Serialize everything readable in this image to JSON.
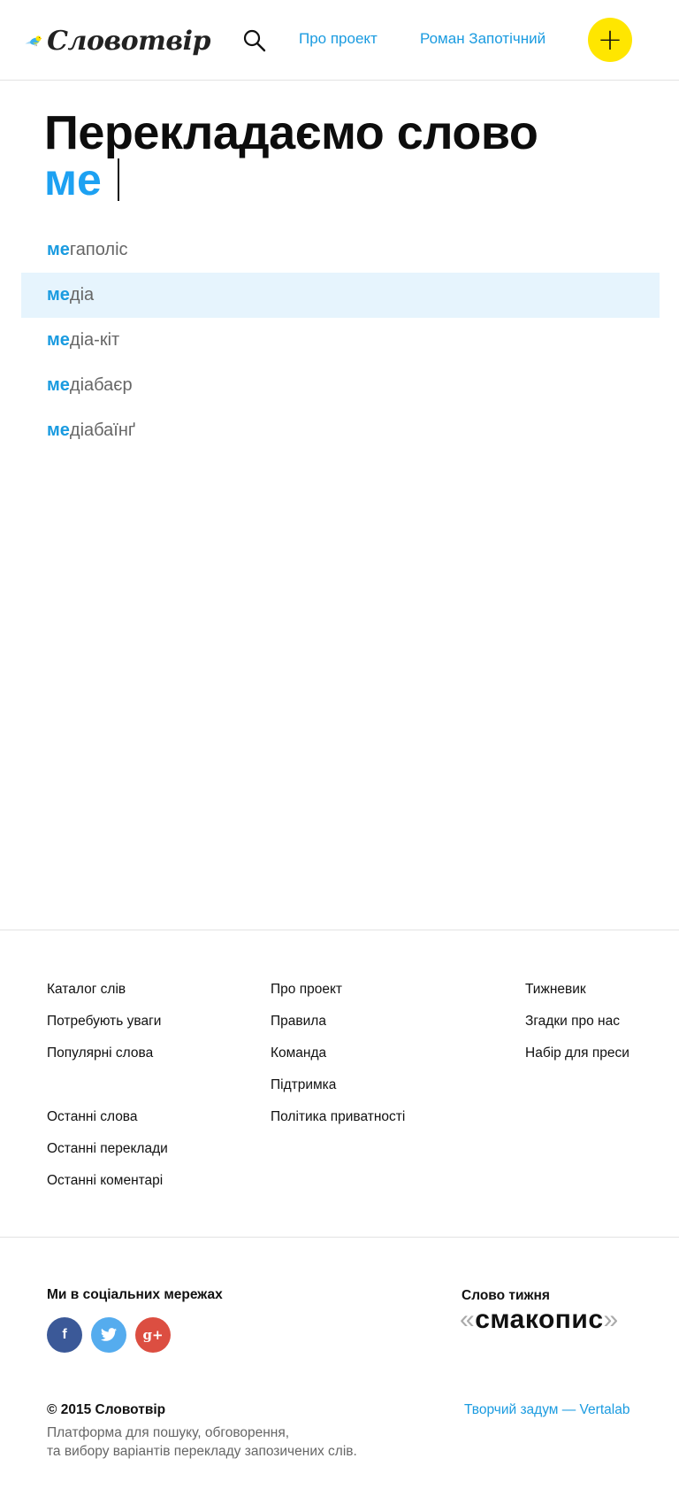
{
  "header": {
    "logo_text": "Словотвір",
    "nav": {
      "about": "Про проект",
      "user": "Роман Запотічний"
    },
    "add_icon": "+"
  },
  "search": {
    "title": "Перекладаємо слово",
    "query": "ме",
    "suggestions": [
      {
        "prefix": "ме",
        "rest": "гаполіс"
      },
      {
        "prefix": "ме",
        "rest": "діа"
      },
      {
        "prefix": "ме",
        "rest": "діа-кіт"
      },
      {
        "prefix": "ме",
        "rest": "діабаєр"
      },
      {
        "prefix": "ме",
        "rest": "діабаїнґ"
      }
    ]
  },
  "footer": {
    "col1": [
      "Каталог слів",
      "Потребують уваги",
      "Популярні слова",
      "Останні слова",
      "Останні переклади",
      "Останні коментарі"
    ],
    "col2": [
      "Про проект",
      "Правила",
      "Команда",
      "Підтримка",
      "Політика приватності"
    ],
    "col3": [
      "Тижневик",
      "Згадки про нас",
      "Набір для преси"
    ],
    "social_title": "Ми в соціальних мережах",
    "social": {
      "facebook": "f",
      "twitter": "t",
      "gplus": "g+"
    },
    "word_of_week_title": "Слово тижня",
    "word_of_week": "смакопис",
    "quote_open": "«",
    "quote_close": "»",
    "copyright": "© 2015 Словотвір",
    "description_line1": "Платформа для пошуку, обговорення,",
    "description_line2": "та вибору варіантів перекладу запозичених слів.",
    "credit": "Творчий задум — Vertalab"
  },
  "colors": {
    "accent": "#1a9be0",
    "add_button": "#ffe600",
    "active_row": "#e6f4fd"
  }
}
